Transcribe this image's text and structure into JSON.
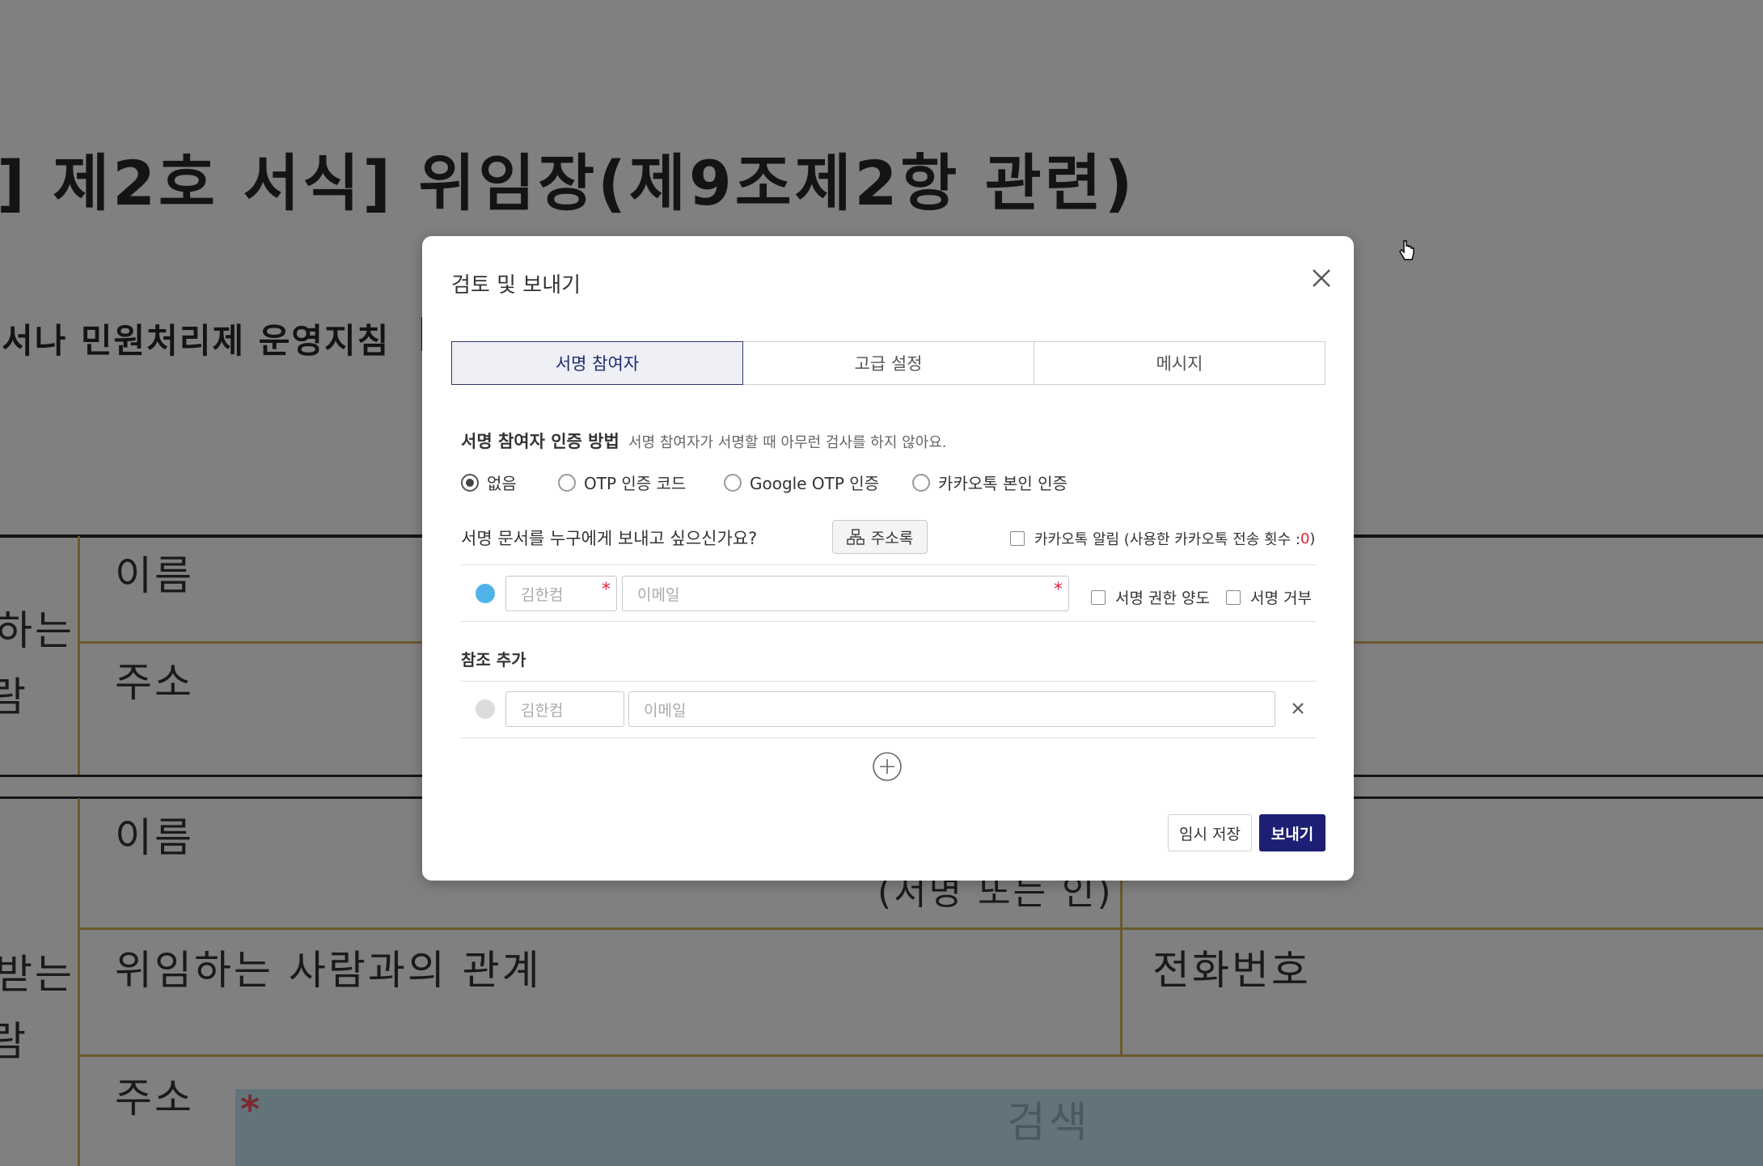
{
  "background_document": {
    "title": "] 제2호 서식] 위임장(제9조제2항 관련)",
    "subtitle": "서나 민원처리제 운영지침",
    "cells": {
      "name_1": "이름",
      "row_left_1a": "하는",
      "row_left_1b": "람",
      "address_1": "주소",
      "name_2": "이름",
      "signature": "(서명 또는 인)",
      "row_left_2a": "받는",
      "row_left_2b": "람",
      "relation": "위임하는 사람과의 관계",
      "phone": "전화번호",
      "address_2": "주소"
    },
    "search_star": "*",
    "search_label": "검색"
  },
  "modal": {
    "title": "검토 및 보내기",
    "tabs": [
      {
        "label": "서명 참여자",
        "active": true
      },
      {
        "label": "고급 설정",
        "active": false
      },
      {
        "label": "메시지",
        "active": false
      }
    ],
    "auth": {
      "label": "서명 참여자 인증 방법",
      "description": "서명 참여자가 서명할 때 아무런 검사를 하지 않아요.",
      "options": [
        {
          "label": "없음",
          "checked": true
        },
        {
          "label": "OTP 인증 코드",
          "checked": false
        },
        {
          "label": "Google OTP 인증",
          "checked": false
        },
        {
          "label": "카카오톡 본인 인증",
          "checked": false
        }
      ]
    },
    "recipients": {
      "question": "서명 문서를 누구에게 보내고 싶으신가요?",
      "address_book_label": "주소록",
      "kakao_notice": "카카오톡 알림 (사용한 카카오톡 전송 횟수 : ",
      "kakao_count": "0",
      "kakao_close": ")",
      "signer": {
        "name_placeholder": "김한컴",
        "email_placeholder": "이메일",
        "required_mark": "*",
        "delegate_label": "서명 권한 양도",
        "reject_label": "서명 거부",
        "color": "#4fb3ea"
      }
    },
    "reference": {
      "title": "참조 추가",
      "name_placeholder": "김한컴",
      "email_placeholder": "이메일",
      "color": "#dcdcdc"
    },
    "buttons": {
      "save_label": "임시 저장",
      "send_label": "보내기"
    }
  }
}
